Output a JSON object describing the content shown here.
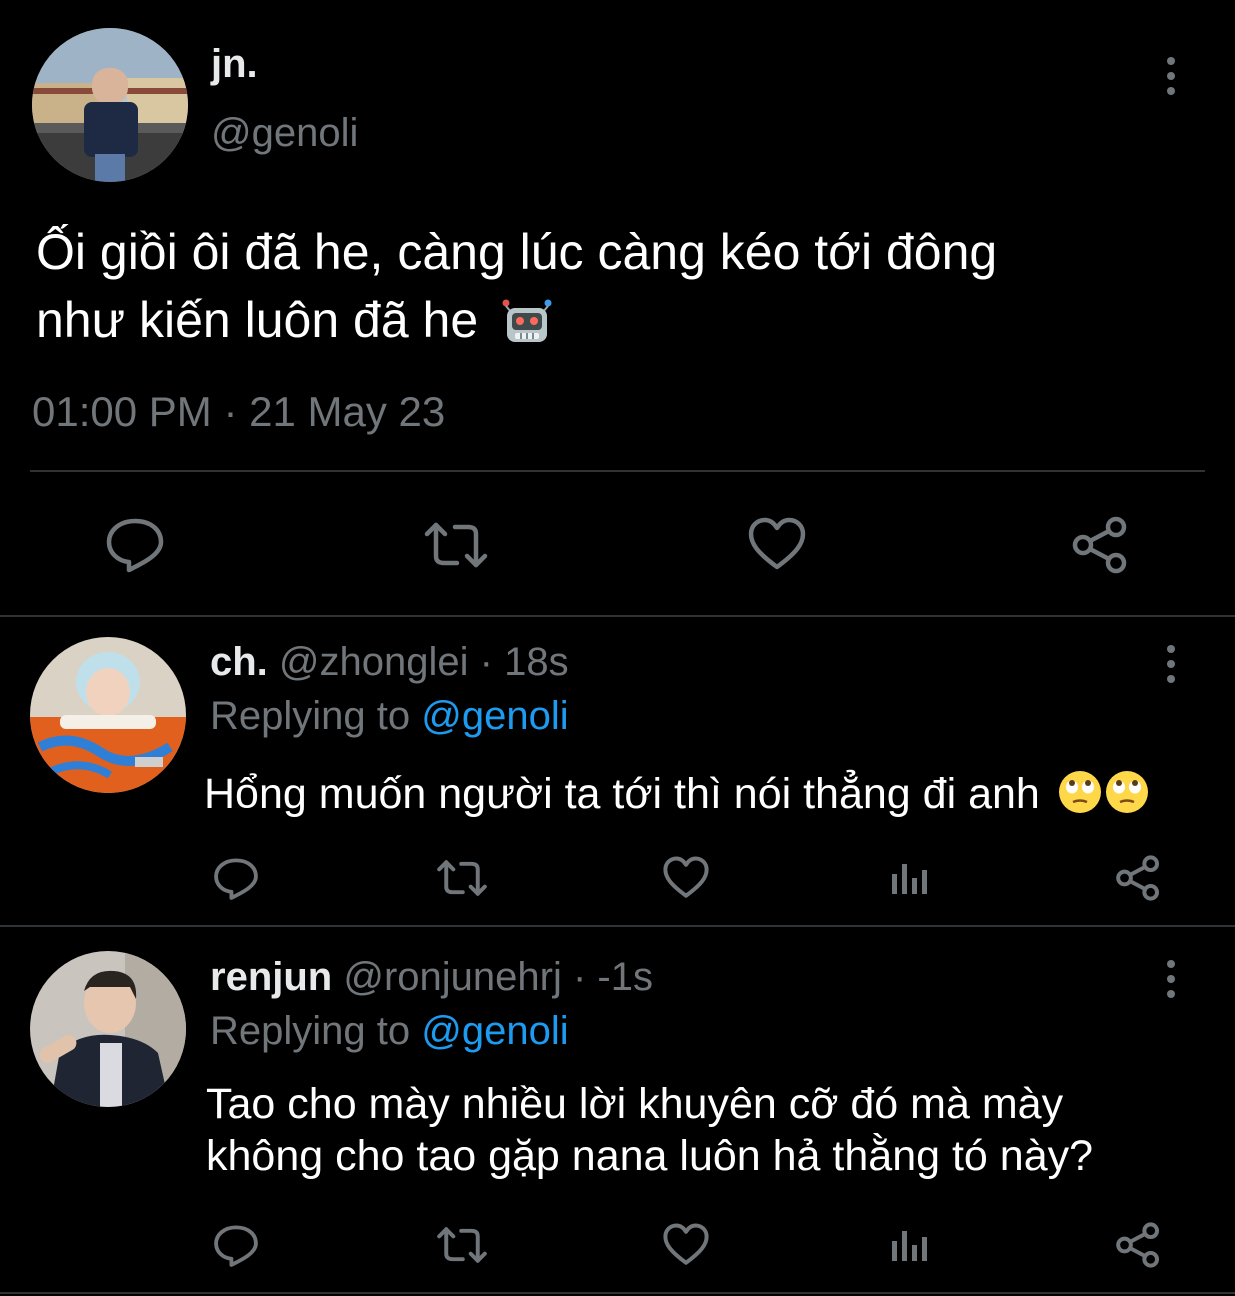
{
  "main_tweet": {
    "display_name": "jn.",
    "handle": "@genoli",
    "text_line1": "Ối giồi ôi đã he, càng lúc càng kéo tới đông",
    "text_line2": "như kiến luôn đã he",
    "emoji": "robot-face",
    "timestamp": "01:00 PM · 21 May 23",
    "actions": [
      "reply-icon",
      "retweet-icon",
      "like-icon",
      "share-icon"
    ]
  },
  "replies": [
    {
      "display_name": "ch.",
      "handle": "@zhonglei",
      "time": "· 18s",
      "replying_label": "Replying to",
      "replying_handle": "@genoli",
      "text": "Hổng muốn người ta tới thì nói thẳng đi anh",
      "emoji": "face-with-rolling-eyes ×2",
      "actions": [
        "reply-icon",
        "retweet-icon",
        "like-icon",
        "analytics-icon",
        "share-icon"
      ]
    },
    {
      "display_name": "renjun",
      "handle": "@ronjunehrj",
      "time": "· -1s",
      "replying_label": "Replying to",
      "replying_handle": "@genoli",
      "text_line1": "Tao cho mày nhiều lời khuyên cỡ đó mà mày",
      "text_line2": "không cho tao gặp nana luôn hả thằng tó này?",
      "actions": [
        "reply-icon",
        "retweet-icon",
        "like-icon",
        "analytics-icon",
        "share-icon"
      ]
    }
  ],
  "colors": {
    "background": "#000000",
    "text": "#e7e9ea",
    "muted": "#71767b",
    "link": "#1d9bf0",
    "divider": "#2f3336"
  }
}
